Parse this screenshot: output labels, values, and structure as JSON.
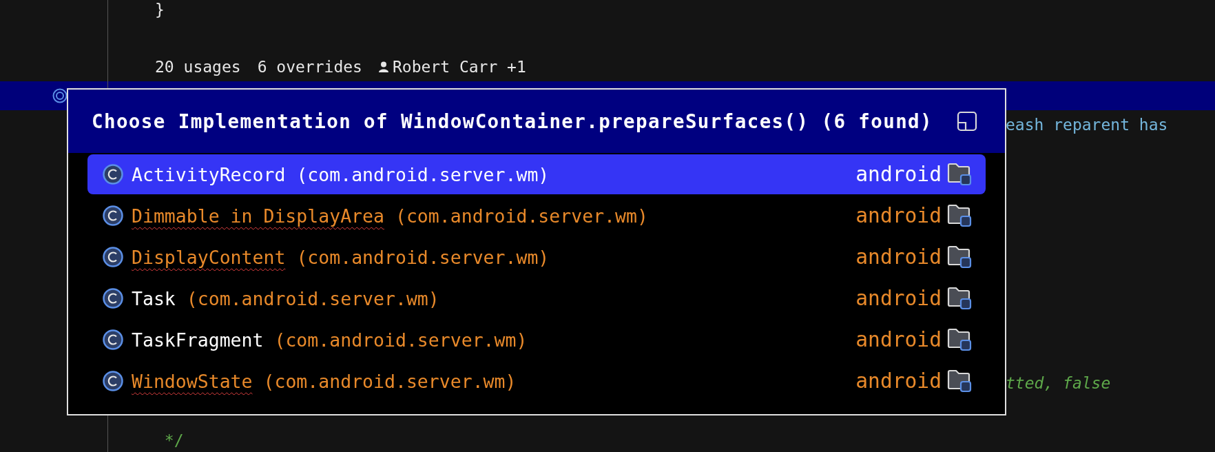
{
  "editor": {
    "lines": [
      {
        "kind": "code",
        "tokens": [
          {
            "kind": "plain",
            "text": "}"
          }
        ]
      },
      {
        "kind": "blank"
      },
      {
        "kind": "lens",
        "usages": "20 usages",
        "overrides": "6 overrides",
        "author": "Robert Carr +1"
      },
      {
        "kind": "current"
      },
      {
        "kind": "tail",
        "tokens": [
          {
            "kind": "doc",
            "text": "eash reparent has"
          }
        ]
      },
      {
        "kind": "blank"
      },
      {
        "kind": "blank"
      },
      {
        "kind": "blank"
      },
      {
        "kind": "blank"
      },
      {
        "kind": "blank"
      },
      {
        "kind": "blank"
      },
      {
        "kind": "blank"
      },
      {
        "kind": "blank"
      },
      {
        "kind": "tail",
        "tokens": [
          {
            "kind": "comment",
            "text": "tted, false"
          }
        ]
      },
      {
        "kind": "blank"
      },
      {
        "kind": "code",
        "tokens": [
          {
            "kind": "comment_plain",
            "text": " */"
          }
        ]
      }
    ]
  },
  "popup": {
    "title": "Choose Implementation of WindowContainer.prepareSurfaces() (6 found)",
    "items": [
      {
        "name": "ActivityRecord",
        "package": "(com.android.server.wm)",
        "module": "android",
        "color": "#ffffff",
        "misspelled": false,
        "selected": true
      },
      {
        "name": "Dimmable in DisplayArea",
        "package": "(com.android.server.wm)",
        "module": "android",
        "color": "#e8892a",
        "misspelled": true,
        "selected": false
      },
      {
        "name": "DisplayContent",
        "package": "(com.android.server.wm)",
        "module": "android",
        "color": "#e8892a",
        "misspelled": true,
        "selected": false
      },
      {
        "name": "Task",
        "package": "(com.android.server.wm)",
        "module": "android",
        "color": "#ffffff",
        "misspelled": false,
        "selected": false
      },
      {
        "name": "TaskFragment",
        "package": "(com.android.server.wm)",
        "module": "android",
        "color": "#ffffff",
        "misspelled": false,
        "selected": false
      },
      {
        "name": "WindowState",
        "package": "(com.android.server.wm)",
        "module": "android",
        "color": "#e8892a",
        "misspelled": true,
        "selected": false
      }
    ]
  }
}
